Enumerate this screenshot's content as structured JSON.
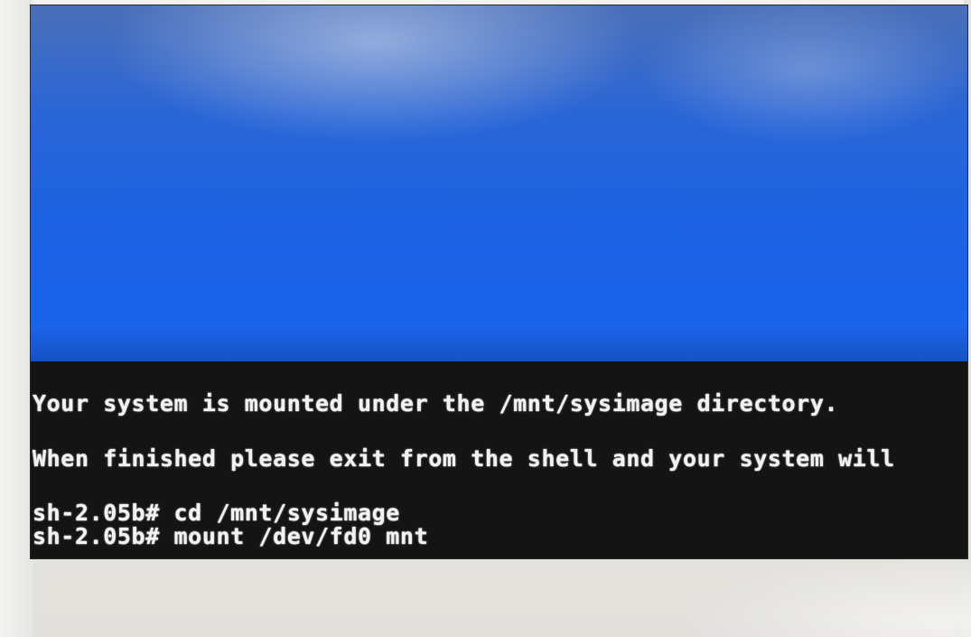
{
  "terminal": {
    "lines": [
      "Your system is mounted under the /mnt/sysimage directory.",
      "When finished please exit from the shell and your system will",
      "sh-2.05b# cd /mnt/sysimage",
      "sh-2.05b# mount /dev/fd0 mnt"
    ]
  }
}
